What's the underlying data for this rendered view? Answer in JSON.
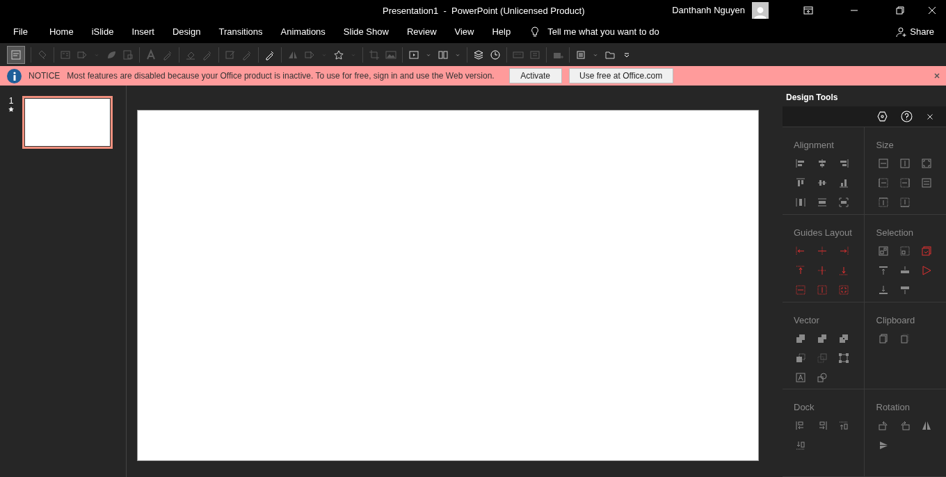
{
  "window": {
    "title": "Presentation1  -  PowerPoint (Unlicensed Product)",
    "user": "Danthanh Nguyen"
  },
  "ribbon_tabs": [
    {
      "label": "File"
    },
    {
      "label": "Home"
    },
    {
      "label": "iSlide"
    },
    {
      "label": "Insert"
    },
    {
      "label": "Design"
    },
    {
      "label": "Transitions"
    },
    {
      "label": "Animations"
    },
    {
      "label": "Slide Show"
    },
    {
      "label": "Review"
    },
    {
      "label": "View"
    },
    {
      "label": "Help"
    }
  ],
  "tell_me": {
    "placeholder": "Tell me what you want to do"
  },
  "share": "Share",
  "notice": {
    "label": "NOTICE",
    "message": "Most features are disabled because your Office product is inactive. To use for free, sign in and use the Web version.",
    "buttons": [
      "Activate",
      "Use free at Office.com"
    ]
  },
  "slides": [
    {
      "number": "1",
      "selected": true
    }
  ],
  "design_tools": {
    "title": "Design Tools",
    "sections": [
      {
        "title": "Alignment"
      },
      {
        "title": "Size"
      },
      {
        "title": "Guides Layout"
      },
      {
        "title": "Selection"
      },
      {
        "title": "Vector"
      },
      {
        "title": "Clipboard"
      },
      {
        "title": "Dock"
      },
      {
        "title": "Rotation"
      }
    ]
  }
}
